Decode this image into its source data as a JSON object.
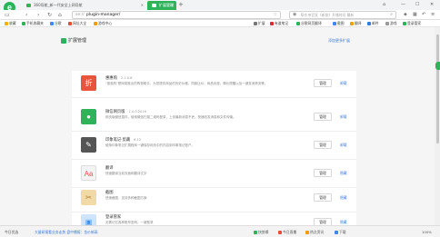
{
  "window": {
    "logo_letter": "e",
    "tabs": [
      {
        "label": "360导航_新一代安全上网导航",
        "active": false
      },
      {
        "label": "扩展管理",
        "active": true
      }
    ],
    "new_tab": "+",
    "controls": {
      "restore": "⌂",
      "minimize": "—",
      "maximize": "☐",
      "close": "✕"
    }
  },
  "address_bar": {
    "prefix": "se://",
    "url": "plugin-manager/",
    "search_placeholder": "靳东亲官宣《新剧》开播时间 最新",
    "toolbar_icons": [
      "shield-icon",
      "grid-icon",
      "undo-icon",
      "menu-icon"
    ]
  },
  "bookmarks": [
    {
      "label": "收藏",
      "color": "#f0b400"
    },
    {
      "label": "手机收藏夹",
      "color": "#2fb35a"
    },
    {
      "label": "谷歌",
      "color": "#4285f4"
    },
    {
      "label": "网址大全",
      "color": "#e74c3c"
    },
    {
      "label": "游戏中心",
      "color": "#f39c12"
    }
  ],
  "bookmarks_right": [
    {
      "label": "扩展",
      "color": "#777777"
    },
    {
      "label": "有道笔记",
      "color": "#d32f2f"
    },
    {
      "label": "谷歌网页翻译",
      "color": "#2fb35a"
    },
    {
      "label": "截图",
      "color": "#4285f4"
    },
    {
      "label": "翻译",
      "color": "#f39c12"
    },
    {
      "label": "邮件",
      "color": "#3a7bd5"
    },
    {
      "label": "游戏",
      "color": "#999999"
    },
    {
      "label": "登录管家",
      "color": "#2fb35a"
    }
  ],
  "page": {
    "title": "扩展管理",
    "more_link": "添加更多扩展"
  },
  "extensions": [
    {
      "name": "惠惠购",
      "version": "2.2.0.8",
      "desc": "\"惠惠购\"是网易推出的购物助手，为您提供商品的历史价格，同款比价，商品优惠，降价提醒以及一键查询物流等。",
      "icon_text": "折",
      "icon_color": "#e8553d",
      "manage": "管理",
      "action": "卸载"
    },
    {
      "name": "微信网页版",
      "version": "1.0.0.2016",
      "desc": "网页版微信插件，使用微信扫描二维码登录，上传最新消息不丢，快速收发消息和文件传输。",
      "icon_text": "●",
      "icon_color": "#2fb35a",
      "manage": "管理",
      "action": "卸载"
    },
    {
      "name": "印象笔记·剪藏",
      "version": "6.12",
      "desc": "使用印象笔记扩展程序一键保存网页中的内容到印象笔记账户。",
      "icon_text": "✎",
      "icon_color": "#555555",
      "manage": "管理",
      "action": "卸载"
    },
    {
      "name": "翻译",
      "version": "",
      "desc": "快速翻译当前页面和翻译文字",
      "icon_text": "Aa",
      "icon_color": "#f4f4f4",
      "manage": "管理",
      "action": "隐藏"
    },
    {
      "name": "截图",
      "version": "",
      "desc": "快速截图，支持多种截图方案",
      "icon_text": "✂",
      "icon_color": "#f1d9a8",
      "manage": "管理",
      "action": "隐藏"
    },
    {
      "name": "登录管家",
      "version": "",
      "desc": "无需记忆各种账号密码，一键登录",
      "icon_text": "▣",
      "icon_color": "#4a90e2",
      "manage": "管理",
      "action": "隐藏"
    }
  ],
  "status_bar": {
    "left": "今日优选",
    "news": "大量研报看业务走势 盘中播报：金价新高",
    "right": [
      {
        "label": "快剪辑",
        "color": "#2fb35a"
      },
      {
        "label": "今日直播",
        "color": "#e74c3c"
      },
      {
        "label": "热点资讯",
        "color": "#f39c12"
      },
      {
        "label": "下载",
        "color": "#4285f4"
      }
    ],
    "zoom": "100%"
  }
}
